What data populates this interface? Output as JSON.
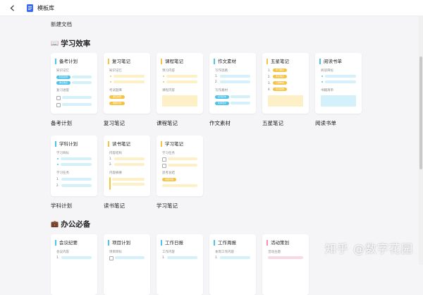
{
  "window": {
    "title": "模板库"
  },
  "new_doc_label": "新建文档",
  "sections": [
    {
      "emoji": "📖",
      "title": "学习效率"
    },
    {
      "emoji": "💼",
      "title": "办公必备"
    }
  ],
  "cards": {
    "beikao": {
      "title": "备考计划",
      "caption": "备考计划",
      "l1": "知识记忆",
      "chip1": "科目名称",
      "chip2": "重点难点",
      "l2": "复习进度"
    },
    "fuxi": {
      "title": "复习笔记",
      "caption": "复习笔记",
      "l1": "知识记忆",
      "l2": "考试题库",
      "chip1": "题目类型",
      "chip2": "错题记录"
    },
    "kecheng": {
      "title": "课程笔记",
      "caption": "课程笔记",
      "l1": "预习内容",
      "l2": "课程内容"
    },
    "zuowen": {
      "title": "作文素材",
      "caption": "作文素材",
      "l1": "写作思路",
      "l2": "写作素材",
      "chip1": "好词好句",
      "chip2": "优秀范文"
    },
    "wuxing": {
      "title": "五星笔记",
      "caption": "五星笔记",
      "chip1": "学习要点",
      "chip2": "重点难点",
      "chip3": "心得体会",
      "chip4": "知识延伸"
    },
    "yuedu": {
      "title": "阅读书单",
      "caption": "阅读书单",
      "l1": "阅读目标",
      "l2": "书籍清单"
    },
    "xueke": {
      "title": "学科计划",
      "caption": "学科计划",
      "l1": "学习目标",
      "l2": "学习任务"
    },
    "dushu": {
      "title": "读书笔记",
      "caption": "读书笔记",
      "l1": "内容结构",
      "l2": "内容摘要"
    },
    "xuexi": {
      "title": "学习笔记",
      "caption": "学习笔记",
      "l1": "学习任务",
      "l2": "思考总结",
      "chip1": "总结内容"
    },
    "huiyi": {
      "title": "会议纪要",
      "l1": "会议内容"
    },
    "xiangmu": {
      "title": "项目计划",
      "l1": "项目目标"
    },
    "ribao": {
      "title": "工作日报",
      "l1": "工作内容"
    },
    "zhoubao": {
      "title": "工作周报",
      "l1": "本周工作内容"
    },
    "huodong": {
      "title": "活动策划",
      "l1": "活动主题"
    }
  },
  "watermark": "知乎 @数字花园",
  "colors": {
    "cyan": "#4fc3e8",
    "yellow": "#f6c343",
    "cyan_light": "#d3f1fa",
    "yellow_light": "#fdf0c7",
    "pink": "#f48fb1"
  }
}
